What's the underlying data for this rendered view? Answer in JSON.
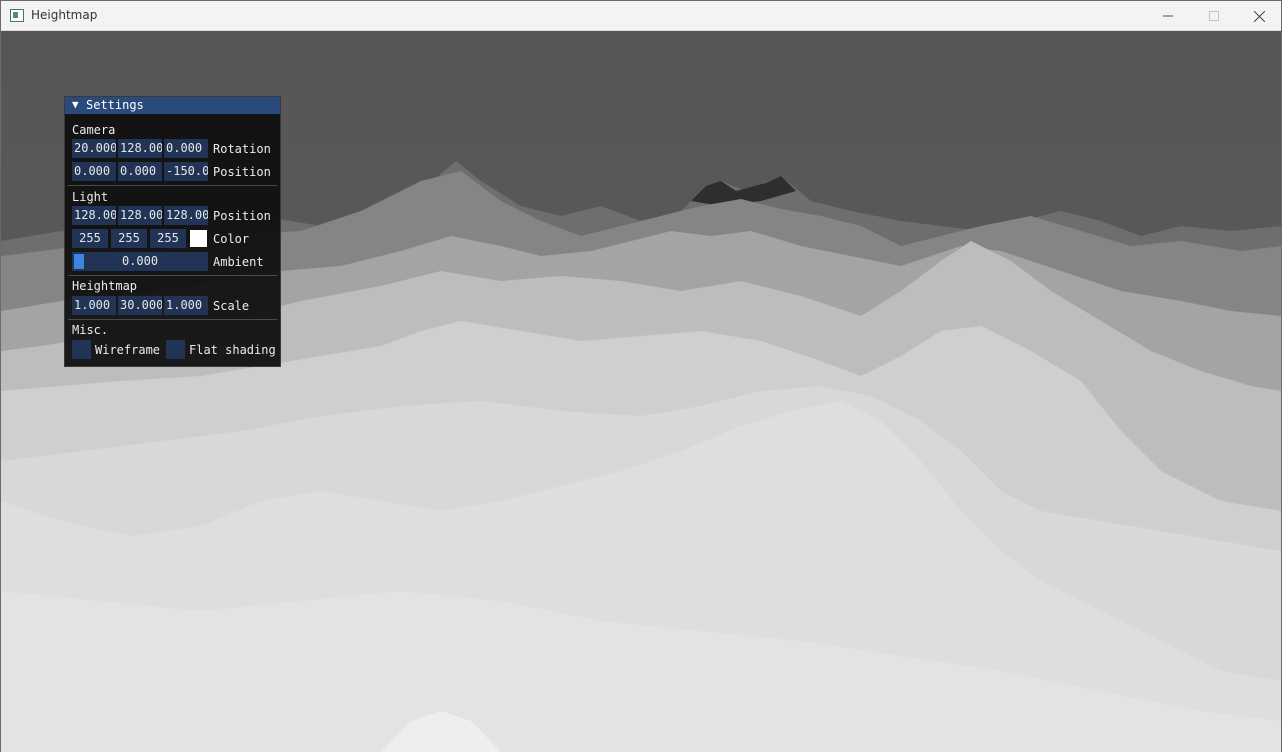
{
  "window": {
    "title": "Heightmap",
    "min_icon": "minimize-icon",
    "max_icon": "maximize-icon",
    "close_icon": "close-icon"
  },
  "settings": {
    "title": "Settings",
    "camera": {
      "header": "Camera",
      "rotation": [
        "20.000",
        "128.00",
        "0.000"
      ],
      "rotation_label": "Rotation",
      "position": [
        "0.000",
        "0.000",
        "-150.0("
      ],
      "position_label": "Position"
    },
    "light": {
      "header": "Light",
      "position": [
        "128.00",
        "128.00",
        "128.00("
      ],
      "position_label": "Position",
      "color": [
        "255",
        "255",
        "255"
      ],
      "color_swatch": "#ffffff",
      "color_label": "Color",
      "ambient_value": "0.000",
      "ambient_label": "Ambient"
    },
    "heightmap": {
      "header": "Heightmap",
      "scale": [
        "1.000",
        "30.000",
        "1.000"
      ],
      "scale_label": "Scale"
    },
    "misc": {
      "header": "Misc.",
      "wireframe_label": "Wireframe",
      "wireframe_checked": false,
      "flat_label": "Flat shading",
      "flat_checked": false
    }
  },
  "colors": {
    "panel_header": "#294a7a",
    "field_bg": "#213456",
    "slider_grab": "#3d85e0",
    "background": "#565656"
  }
}
